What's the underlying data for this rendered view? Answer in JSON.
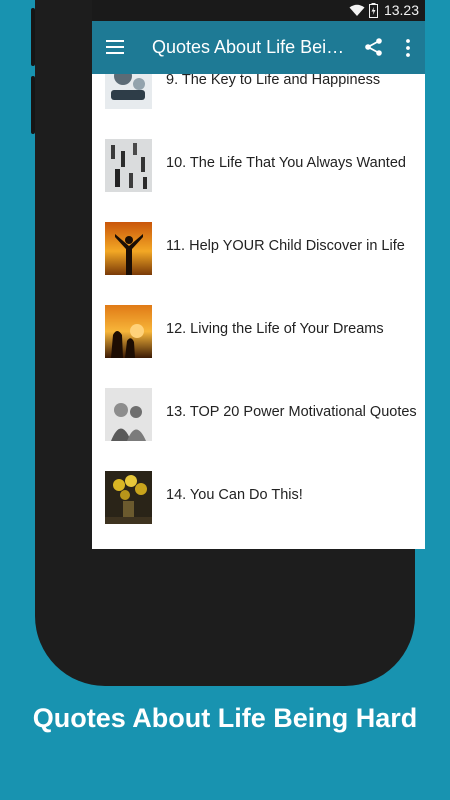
{
  "status_bar": {
    "time": "13.23"
  },
  "app_bar": {
    "title": "Quotes About Life Being Hard"
  },
  "list": {
    "items": [
      {
        "label": "9. The Key to Life and Happiness"
      },
      {
        "label": "10. The Life That You Always Wanted"
      },
      {
        "label": "11. Help YOUR Child Discover in Life"
      },
      {
        "label": "12. Living the Life of Your Dreams"
      },
      {
        "label": "13. TOP 20 Power Motivational Quotes"
      },
      {
        "label": "14. You Can Do This!"
      }
    ]
  },
  "caption": "Quotes About Life Being Hard",
  "colors": {
    "background": "#1893b0",
    "app_bar": "#1e7a95",
    "phone_frame": "#1d1d1d"
  }
}
